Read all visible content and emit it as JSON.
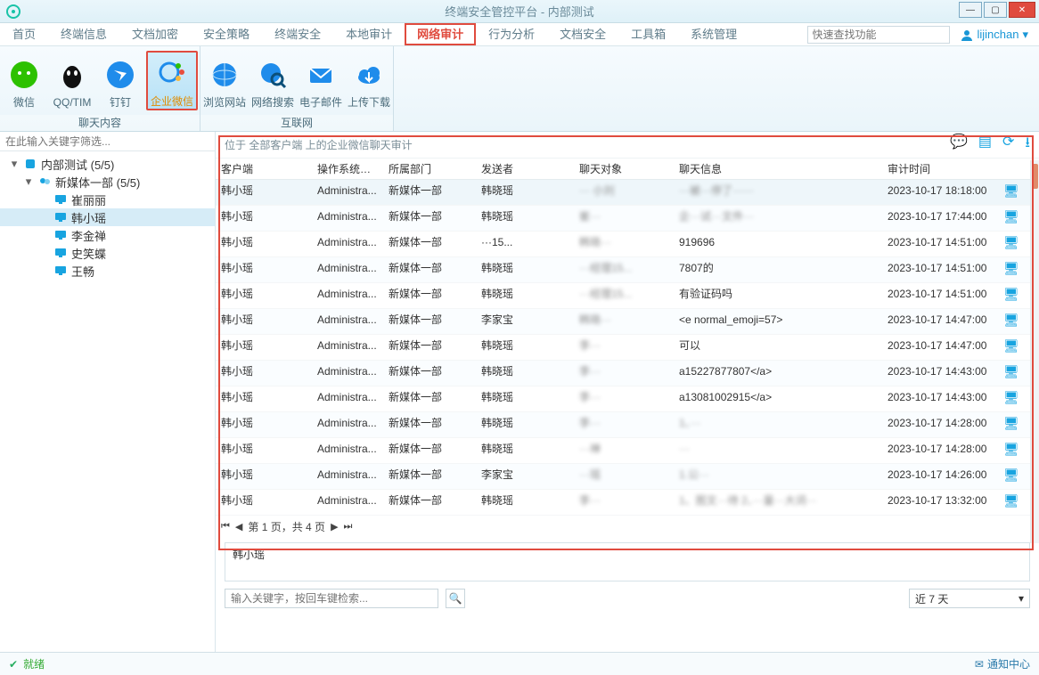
{
  "window": {
    "title": "终端安全管控平台 - 内部测试"
  },
  "menu": {
    "items": [
      "首页",
      "终端信息",
      "文档加密",
      "安全策略",
      "终端安全",
      "本地审计",
      "网络审计",
      "行为分析",
      "文档安全",
      "工具箱",
      "系统管理"
    ],
    "active": 6,
    "search_placeholder": "快速查找功能",
    "user": "lijinchan"
  },
  "ribbon": {
    "groups": [
      {
        "label": "聊天内容",
        "items": [
          {
            "cap": "微信",
            "icon": "wechat"
          },
          {
            "cap": "QQ/TIM",
            "icon": "qq"
          },
          {
            "cap": "钉钉",
            "icon": "dingtalk"
          },
          {
            "cap": "企业微信",
            "icon": "wecom",
            "active": true
          }
        ]
      },
      {
        "label": "互联网",
        "items": [
          {
            "cap": "浏览网站",
            "icon": "globe"
          },
          {
            "cap": "网络搜索",
            "icon": "search-globe"
          },
          {
            "cap": "电子邮件",
            "icon": "mail"
          },
          {
            "cap": "上传下载",
            "icon": "cloud"
          }
        ]
      }
    ]
  },
  "sidebar": {
    "filter_placeholder": "在此输入关键字筛选...",
    "root": {
      "label": "内部测试 (5/5)"
    },
    "group": {
      "label": "新媒体一部 (5/5)"
    },
    "leaves": [
      "崔丽丽",
      "韩小瑶",
      "李金禅",
      "史笑蝶",
      "王畅"
    ],
    "selected": 1
  },
  "panel": {
    "caption": "位于 全部客户端 上的企业微信聊天审计",
    "toolicons": [
      "chat-icon",
      "list-icon",
      "refresh-icon",
      "download-icon"
    ]
  },
  "grid": {
    "columns": [
      "客户端",
      "操作系统账户",
      "所属部门",
      "发送者",
      "聊天对象",
      "聊天信息",
      "审计时间",
      ""
    ],
    "rows": [
      {
        "c": "韩小瑶",
        "os": "Administra...",
        "dept": "新媒体一部",
        "sender": "韩晓瑶",
        "peer": "··· 小刘",
        "msg": "···被···停了······",
        "time": "2023-10-17 18:18:00",
        "sel": true
      },
      {
        "c": "韩小瑶",
        "os": "Administra...",
        "dept": "新媒体一部",
        "sender": "韩晓瑶",
        "peer": "崔···",
        "msg": "企···试···文件···",
        "time": "2023-10-17 17:44:00"
      },
      {
        "c": "韩小瑶",
        "os": "Administra...",
        "dept": "新媒体一部",
        "sender": "···15...",
        "peer": "韩晓···",
        "msg": "919696",
        "time": "2023-10-17 14:51:00"
      },
      {
        "c": "韩小瑶",
        "os": "Administra...",
        "dept": "新媒体一部",
        "sender": "韩晓瑶",
        "peer": "···经理15...",
        "msg": "7807的",
        "time": "2023-10-17 14:51:00"
      },
      {
        "c": "韩小瑶",
        "os": "Administra...",
        "dept": "新媒体一部",
        "sender": "韩晓瑶",
        "peer": "···经理15...",
        "msg": "有验证码吗",
        "time": "2023-10-17 14:51:00"
      },
      {
        "c": "韩小瑶",
        "os": "Administra...",
        "dept": "新媒体一部",
        "sender": "李家宝",
        "peer": "韩晓···",
        "msg": "<e normal_emoji=57>",
        "time": "2023-10-17 14:47:00"
      },
      {
        "c": "韩小瑶",
        "os": "Administra...",
        "dept": "新媒体一部",
        "sender": "韩晓瑶",
        "peer": "李···",
        "msg": "可以",
        "time": "2023-10-17 14:47:00"
      },
      {
        "c": "韩小瑶",
        "os": "Administra...",
        "dept": "新媒体一部",
        "sender": "韩晓瑶",
        "peer": "李···",
        "msg": "a15227877807</a>",
        "time": "2023-10-17 14:43:00"
      },
      {
        "c": "韩小瑶",
        "os": "Administra...",
        "dept": "新媒体一部",
        "sender": "韩晓瑶",
        "peer": "李···",
        "msg": "a13081002915</a>",
        "time": "2023-10-17 14:43:00"
      },
      {
        "c": "韩小瑶",
        "os": "Administra...",
        "dept": "新媒体一部",
        "sender": "韩晓瑶",
        "peer": "李···",
        "msg": "1、···",
        "time": "2023-10-17 14:28:00"
      },
      {
        "c": "韩小瑶",
        "os": "Administra...",
        "dept": "新媒体一部",
        "sender": "韩晓瑶",
        "peer": "···禅",
        "msg": "···",
        "time": "2023-10-17 14:28:00"
      },
      {
        "c": "韩小瑶",
        "os": "Administra...",
        "dept": "新媒体一部",
        "sender": "李家宝",
        "peer": "···瑶",
        "msg": "1.公···",
        "time": "2023-10-17 14:26:00"
      },
      {
        "c": "韩小瑶",
        "os": "Administra...",
        "dept": "新媒体一部",
        "sender": "韩晓瑶",
        "peer": "李···",
        "msg": "1、图文···待 2、···量···大词···",
        "time": "2023-10-17 13:32:00"
      }
    ]
  },
  "pager": {
    "text": "第 1 页，共 4 页"
  },
  "detail": {
    "text": "韩小瑶"
  },
  "bottom": {
    "kw_placeholder": "输入关键字，按回车键检索...",
    "range": "近 7 天"
  },
  "status": {
    "text": "就绪",
    "notify": "通知中心"
  }
}
